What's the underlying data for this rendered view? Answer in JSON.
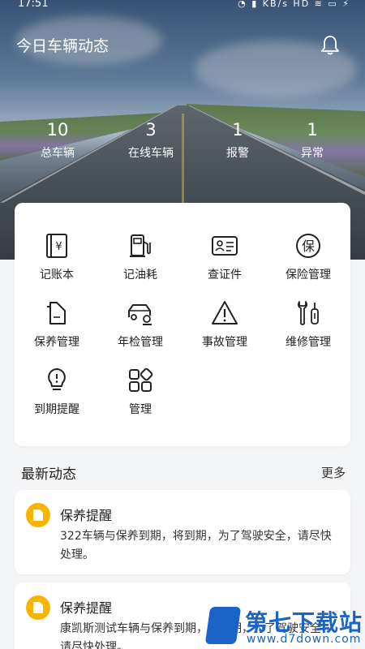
{
  "status_bar": {
    "time": "17:51",
    "icons": "◔ ▮ KB/s HD ≋ ▭ ⚡"
  },
  "header": {
    "title": "今日车辆动态"
  },
  "stats": [
    {
      "value": "10",
      "label": "总车辆"
    },
    {
      "value": "3",
      "label": "在线车辆"
    },
    {
      "value": "1",
      "label": "报警"
    },
    {
      "value": "1",
      "label": "异常"
    }
  ],
  "grid": [
    {
      "label": "记账本",
      "icon": "ledger-icon"
    },
    {
      "label": "记油耗",
      "icon": "fuel-pump-icon"
    },
    {
      "label": "查证件",
      "icon": "id-card-icon"
    },
    {
      "label": "保险管理",
      "icon": "insurance-icon"
    },
    {
      "label": "保养管理",
      "icon": "oil-can-icon"
    },
    {
      "label": "年检管理",
      "icon": "car-stamp-icon"
    },
    {
      "label": "事故管理",
      "icon": "warning-icon"
    },
    {
      "label": "维修管理",
      "icon": "wrench-icon"
    },
    {
      "label": "到期提醒",
      "icon": "bulb-icon"
    },
    {
      "label": "管理",
      "icon": "apps-icon"
    }
  ],
  "section": {
    "title": "最新动态",
    "more": "更多"
  },
  "news": [
    {
      "title": "保养提醒",
      "text": "322车辆与保养到期，将到期，为了驾驶安全，请尽快处理。"
    },
    {
      "title": "保养提醒",
      "text": "康凯斯测试车辆与保养到期，将到期，为了驾驶安全，请尽快处理。"
    }
  ],
  "watermark": {
    "text": "第七下载站",
    "url": "www.d7down.com"
  },
  "colors": {
    "accent": "#f7b500",
    "brand": "#1a64c8"
  }
}
